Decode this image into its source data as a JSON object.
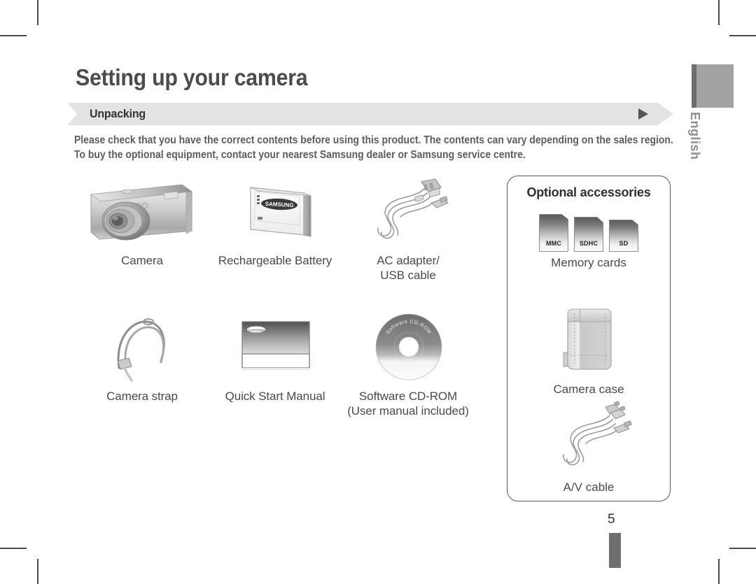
{
  "page": {
    "title": "Setting up your camera",
    "section": "Unpacking",
    "intro_line1": "Please check that you have the correct contents before using this product. The contents can vary depending on the sales region.",
    "intro_line2": "To buy the optional equipment, contact your nearest Samsung dealer or Samsung service centre.",
    "page_number": "5",
    "language_tab": "English"
  },
  "items": [
    {
      "label": "Camera",
      "sub": "",
      "icon": "camera-illustration"
    },
    {
      "label": "Rechargeable Battery",
      "sub": "",
      "icon": "battery-illustration"
    },
    {
      "label": "AC adapter/",
      "sub": "USB cable",
      "icon": "ac-adapter-usb-cable-illustration"
    },
    {
      "label": "Camera strap",
      "sub": "",
      "icon": "camera-strap-illustration"
    },
    {
      "label": "Quick Start Manual",
      "sub": "",
      "icon": "quick-start-manual-illustration"
    },
    {
      "label": "Software CD-ROM",
      "sub": "(User manual included)",
      "icon": "software-cd-rom-illustration"
    }
  ],
  "optional": {
    "title": "Optional accessories",
    "memory_cards": {
      "caption": "Memory cards",
      "cards": [
        "MMC",
        "SDHC",
        "SD"
      ]
    },
    "camera_case": {
      "caption": "Camera case",
      "icon": "camera-case-illustration"
    },
    "av_cable": {
      "caption": "A/V cable",
      "icon": "av-cable-illustration"
    }
  },
  "artwork": {
    "battery_brand": "SAMSUNG",
    "manual_brand": "SAMSUNG",
    "cd_label": "Software CD-ROM"
  },
  "colors": {
    "bar_background": "#e3e3e3",
    "bar_arrow": "#555555",
    "title_text": "#4c4c4c",
    "body_text": "#5d5d5d",
    "caption_text": "#4a4a4a",
    "tab": "#a3a3a3",
    "tab_edge": "#6d6d6d"
  }
}
